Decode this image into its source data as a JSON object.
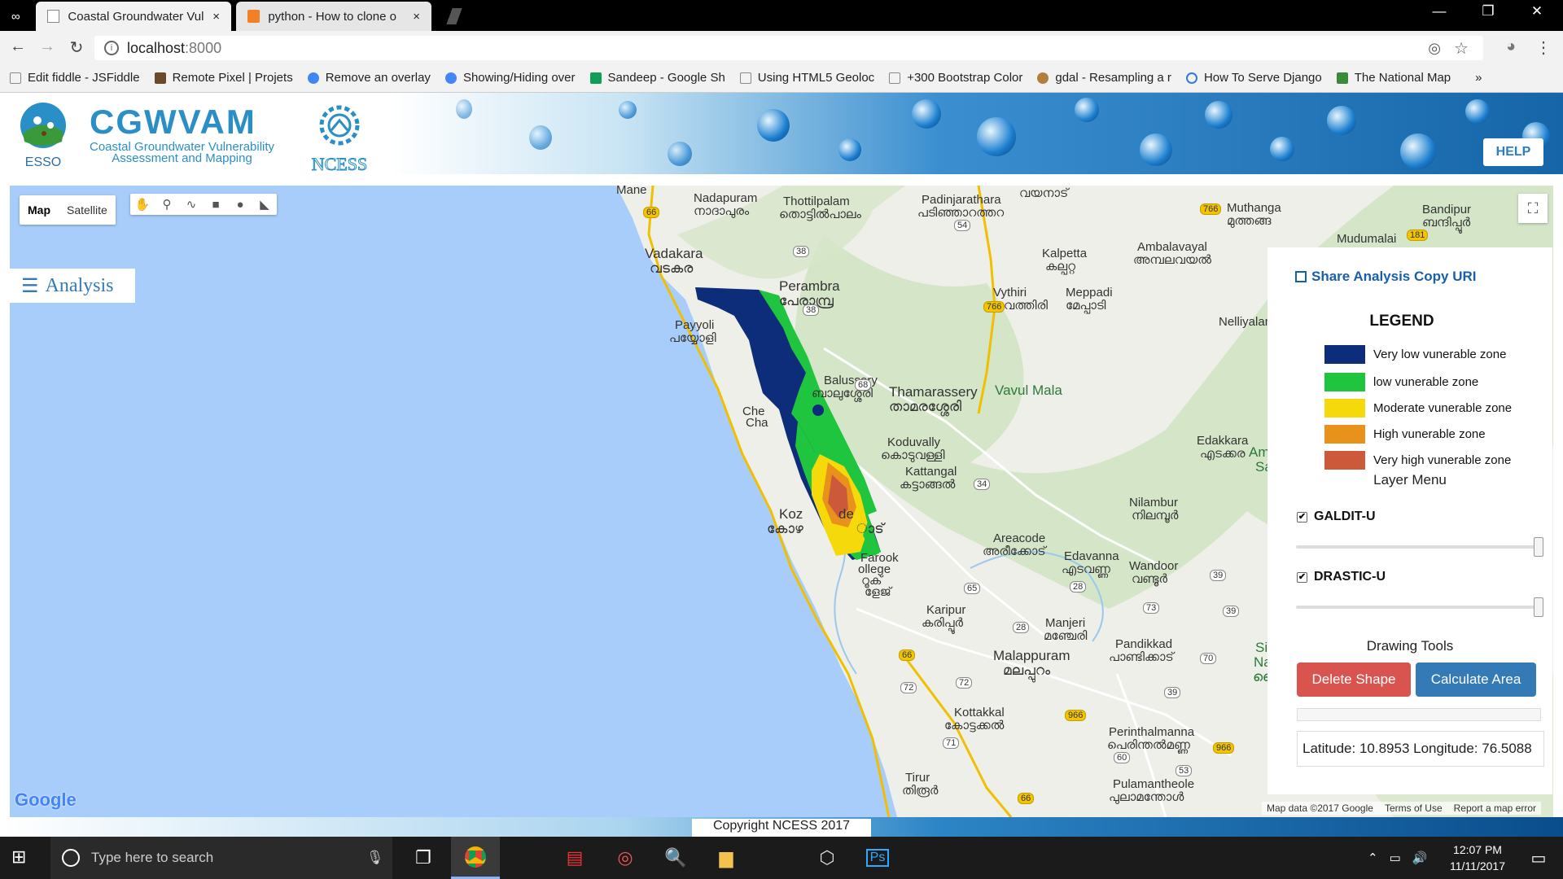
{
  "browser": {
    "tabs": [
      {
        "title": "Coastal Groundwater Vul",
        "close": "×"
      },
      {
        "title": "python - How to clone o",
        "close": "×"
      }
    ],
    "window_controls": [
      "—",
      "❐",
      "✕"
    ],
    "url_host": "localhost",
    "url_port": ":8000",
    "bookmarks": [
      {
        "label": "Edit fiddle - JSFiddle",
        "color": "#888"
      },
      {
        "label": "Remote Pixel | Projets",
        "color": "#6a4a2a"
      },
      {
        "label": "Remove an overlay",
        "color": "#4285f4"
      },
      {
        "label": "Showing/Hiding over",
        "color": "#4285f4"
      },
      {
        "label": "Sandeep - Google Sh",
        "color": "#0f9d58"
      },
      {
        "label": "Using HTML5 Geoloc",
        "color": "#888"
      },
      {
        "label": "+300 Bootstrap Color",
        "color": "#888"
      },
      {
        "label": "gdal - Resampling a r",
        "color": "#b08040"
      },
      {
        "label": "How To Serve Django",
        "color": "#2f7be0"
      },
      {
        "label": "The National Map",
        "color": "#3a8a3a"
      }
    ],
    "bookmarks_more": "»"
  },
  "header": {
    "esso_label": "ESSO",
    "app_name": "CGWVAM",
    "app_subtitle_1": "Coastal Groundwater Vulnerability",
    "app_subtitle_2": "Assessment and Mapping",
    "ncess_label": "NCESS",
    "help_label": "HELP"
  },
  "map": {
    "type_map": "Map",
    "type_satellite": "Satellite",
    "analysis_label": "Analysis",
    "google_label": "Google",
    "footer_data": "Map data ©2017 Google",
    "footer_terms": "Terms of Use",
    "footer_report": "Report a map error",
    "places": [
      {
        "text": "Mane"
      },
      {
        "text": "Nadapuram"
      },
      {
        "text": "നാദാപുരം"
      },
      {
        "text": "Thottilpalam"
      },
      {
        "text": "തൊട്ടിൽപാലം"
      },
      {
        "text": "Padinjarathara"
      },
      {
        "text": "പടിഞ്ഞാറത്തറ"
      },
      {
        "text": "വയനാട്"
      },
      {
        "text": "Muthanga"
      },
      {
        "text": "മുത്തങ്ങ"
      },
      {
        "text": "Bandipur"
      },
      {
        "text": "ബന്ദിപ്പൂർ"
      },
      {
        "text": "Mudumalai"
      },
      {
        "text": "Vadakara"
      },
      {
        "text": "വടകര"
      },
      {
        "text": "Kalpetta"
      },
      {
        "text": "കല്പറ്റ"
      },
      {
        "text": "Ambalavayal"
      },
      {
        "text": "അമ്പലവയൽ"
      },
      {
        "text": "Perambra"
      },
      {
        "text": "പേരാമ്പ്ര"
      },
      {
        "text": "Vythiri"
      },
      {
        "text": "വൈത്തിരി"
      },
      {
        "text": "Meppadi"
      },
      {
        "text": "മേപ്പാടി"
      },
      {
        "text": "Payyoli"
      },
      {
        "text": "പയ്യോളി"
      },
      {
        "text": "Nelliyalar"
      },
      {
        "text": "Balussery"
      },
      {
        "text": "ബാലുശ്ശേരി"
      },
      {
        "text": "Thamarassery"
      },
      {
        "text": "താമരശ്ശേരി"
      },
      {
        "text": "Vavul Mala"
      },
      {
        "text": "Che"
      },
      {
        "text": "Cha"
      },
      {
        "text": "Koduvally"
      },
      {
        "text": "കൊടുവള്ളി"
      },
      {
        "text": "Edakkara"
      },
      {
        "text": "എടക്കര"
      },
      {
        "text": "Ama"
      },
      {
        "text": "Sa"
      },
      {
        "text": "Kattangal"
      },
      {
        "text": "കട്ടാങ്ങൽ"
      },
      {
        "text": "Nilambur"
      },
      {
        "text": "നിലമ്പൂർ"
      },
      {
        "text": "Koz"
      },
      {
        "text": "de"
      },
      {
        "text": "കോഴ"
      },
      {
        "text": "ാട്"
      },
      {
        "text": "Areacode"
      },
      {
        "text": "അരീക്കോട്"
      },
      {
        "text": "Edavanna"
      },
      {
        "text": "എടവണ്ണ"
      },
      {
        "text": "Wandoor"
      },
      {
        "text": "വണ്ടൂർ"
      },
      {
        "text": "Farook"
      },
      {
        "text": "ollege"
      },
      {
        "text": "റൂക്"
      },
      {
        "text": "ളേജ്"
      },
      {
        "text": "Karipur"
      },
      {
        "text": "കരിപ്പൂർ"
      },
      {
        "text": "Manjeri"
      },
      {
        "text": "മഞ്ചേരി"
      },
      {
        "text": "Pandikkad"
      },
      {
        "text": "പാണ്ടിക്കാട്"
      },
      {
        "text": "Malappuram"
      },
      {
        "text": "മലപ്പുറം"
      },
      {
        "text": "Si"
      },
      {
        "text": "Na"
      },
      {
        "text": "ദൈ"
      },
      {
        "text": "Kottakkal"
      },
      {
        "text": "കോട്ടക്കൽ"
      },
      {
        "text": "Perinthalmanna"
      },
      {
        "text": "പെരിന്തൽമണ്ണ"
      },
      {
        "text": "Tirur"
      },
      {
        "text": "തിരൂർ"
      },
      {
        "text": "Pulamantheole"
      },
      {
        "text": "പുലാമന്തോൾ"
      }
    ],
    "roads": [
      {
        "n": "66",
        "c": "yellow"
      },
      {
        "n": "766",
        "c": "yellow"
      },
      {
        "n": "181",
        "c": "yellow"
      },
      {
        "n": "54",
        "c": "white"
      },
      {
        "n": "38",
        "c": "white"
      },
      {
        "n": "38",
        "c": "white"
      },
      {
        "n": "766",
        "c": "yellow"
      },
      {
        "n": "68",
        "c": "white"
      },
      {
        "n": "34",
        "c": "white"
      },
      {
        "n": "65",
        "c": "white"
      },
      {
        "n": "28",
        "c": "white"
      },
      {
        "n": "39",
        "c": "white"
      },
      {
        "n": "73",
        "c": "white"
      },
      {
        "n": "39",
        "c": "white"
      },
      {
        "n": "28",
        "c": "white"
      },
      {
        "n": "66",
        "c": "yellow"
      },
      {
        "n": "70",
        "c": "white"
      },
      {
        "n": "72",
        "c": "white"
      },
      {
        "n": "72",
        "c": "white"
      },
      {
        "n": "39",
        "c": "white"
      },
      {
        "n": "966",
        "c": "yellow"
      },
      {
        "n": "71",
        "c": "white"
      },
      {
        "n": "60",
        "c": "white"
      },
      {
        "n": "966",
        "c": "yellow"
      },
      {
        "n": "53",
        "c": "white"
      },
      {
        "n": "66",
        "c": "yellow"
      }
    ]
  },
  "panel": {
    "share_label": "Share Analysis Copy URI",
    "legend_title": "LEGEND",
    "legend": [
      {
        "label": "Very low vunerable zone",
        "color": "#0d2d7a"
      },
      {
        "label": "low vunerable zone",
        "color": "#1fc43f"
      },
      {
        "label": "Moderate vunerable zone",
        "color": "#f5d90a"
      },
      {
        "label": "High vunerable zone",
        "color": "#e8921c"
      },
      {
        "label": "Very high vunerable zone",
        "color": "#cc5a3a"
      }
    ],
    "layer_menu_label": "Layer Menu",
    "layers": [
      {
        "label": "GALDIT-U",
        "checked": "✔",
        "opacity": 1.0
      },
      {
        "label": "DRASTIC-U",
        "checked": "✔",
        "opacity": 1.0
      }
    ],
    "drawing_tools_label": "Drawing Tools",
    "delete_label": "Delete Shape",
    "calculate_label": "Calculate Area",
    "coordinates": "Latitude: 10.8953 Longitude: 76.5088"
  },
  "footer": {
    "copyright": "Copyright NCESS 2017"
  },
  "taskbar": {
    "search_placeholder": "Type here to search",
    "time": "12:07 PM",
    "date": "11/11/2017"
  }
}
